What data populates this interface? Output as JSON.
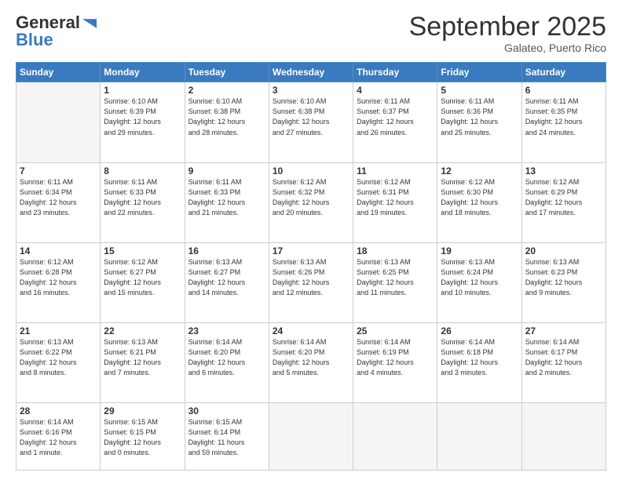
{
  "header": {
    "logo_general": "General",
    "logo_blue": "Blue",
    "month_title": "September 2025",
    "location": "Galateo, Puerto Rico"
  },
  "weekdays": [
    "Sunday",
    "Monday",
    "Tuesday",
    "Wednesday",
    "Thursday",
    "Friday",
    "Saturday"
  ],
  "weeks": [
    [
      {
        "day": "",
        "info": ""
      },
      {
        "day": "1",
        "info": "Sunrise: 6:10 AM\nSunset: 6:39 PM\nDaylight: 12 hours\nand 29 minutes."
      },
      {
        "day": "2",
        "info": "Sunrise: 6:10 AM\nSunset: 6:38 PM\nDaylight: 12 hours\nand 28 minutes."
      },
      {
        "day": "3",
        "info": "Sunrise: 6:10 AM\nSunset: 6:38 PM\nDaylight: 12 hours\nand 27 minutes."
      },
      {
        "day": "4",
        "info": "Sunrise: 6:11 AM\nSunset: 6:37 PM\nDaylight: 12 hours\nand 26 minutes."
      },
      {
        "day": "5",
        "info": "Sunrise: 6:11 AM\nSunset: 6:36 PM\nDaylight: 12 hours\nand 25 minutes."
      },
      {
        "day": "6",
        "info": "Sunrise: 6:11 AM\nSunset: 6:35 PM\nDaylight: 12 hours\nand 24 minutes."
      }
    ],
    [
      {
        "day": "7",
        "info": "Sunrise: 6:11 AM\nSunset: 6:34 PM\nDaylight: 12 hours\nand 23 minutes."
      },
      {
        "day": "8",
        "info": "Sunrise: 6:11 AM\nSunset: 6:33 PM\nDaylight: 12 hours\nand 22 minutes."
      },
      {
        "day": "9",
        "info": "Sunrise: 6:11 AM\nSunset: 6:33 PM\nDaylight: 12 hours\nand 21 minutes."
      },
      {
        "day": "10",
        "info": "Sunrise: 6:12 AM\nSunset: 6:32 PM\nDaylight: 12 hours\nand 20 minutes."
      },
      {
        "day": "11",
        "info": "Sunrise: 6:12 AM\nSunset: 6:31 PM\nDaylight: 12 hours\nand 19 minutes."
      },
      {
        "day": "12",
        "info": "Sunrise: 6:12 AM\nSunset: 6:30 PM\nDaylight: 12 hours\nand 18 minutes."
      },
      {
        "day": "13",
        "info": "Sunrise: 6:12 AM\nSunset: 6:29 PM\nDaylight: 12 hours\nand 17 minutes."
      }
    ],
    [
      {
        "day": "14",
        "info": "Sunrise: 6:12 AM\nSunset: 6:28 PM\nDaylight: 12 hours\nand 16 minutes."
      },
      {
        "day": "15",
        "info": "Sunrise: 6:12 AM\nSunset: 6:27 PM\nDaylight: 12 hours\nand 15 minutes."
      },
      {
        "day": "16",
        "info": "Sunrise: 6:13 AM\nSunset: 6:27 PM\nDaylight: 12 hours\nand 14 minutes."
      },
      {
        "day": "17",
        "info": "Sunrise: 6:13 AM\nSunset: 6:26 PM\nDaylight: 12 hours\nand 12 minutes."
      },
      {
        "day": "18",
        "info": "Sunrise: 6:13 AM\nSunset: 6:25 PM\nDaylight: 12 hours\nand 11 minutes."
      },
      {
        "day": "19",
        "info": "Sunrise: 6:13 AM\nSunset: 6:24 PM\nDaylight: 12 hours\nand 10 minutes."
      },
      {
        "day": "20",
        "info": "Sunrise: 6:13 AM\nSunset: 6:23 PM\nDaylight: 12 hours\nand 9 minutes."
      }
    ],
    [
      {
        "day": "21",
        "info": "Sunrise: 6:13 AM\nSunset: 6:22 PM\nDaylight: 12 hours\nand 8 minutes."
      },
      {
        "day": "22",
        "info": "Sunrise: 6:13 AM\nSunset: 6:21 PM\nDaylight: 12 hours\nand 7 minutes."
      },
      {
        "day": "23",
        "info": "Sunrise: 6:14 AM\nSunset: 6:20 PM\nDaylight: 12 hours\nand 6 minutes."
      },
      {
        "day": "24",
        "info": "Sunrise: 6:14 AM\nSunset: 6:20 PM\nDaylight: 12 hours\nand 5 minutes."
      },
      {
        "day": "25",
        "info": "Sunrise: 6:14 AM\nSunset: 6:19 PM\nDaylight: 12 hours\nand 4 minutes."
      },
      {
        "day": "26",
        "info": "Sunrise: 6:14 AM\nSunset: 6:18 PM\nDaylight: 12 hours\nand 3 minutes."
      },
      {
        "day": "27",
        "info": "Sunrise: 6:14 AM\nSunset: 6:17 PM\nDaylight: 12 hours\nand 2 minutes."
      }
    ],
    [
      {
        "day": "28",
        "info": "Sunrise: 6:14 AM\nSunset: 6:16 PM\nDaylight: 12 hours\nand 1 minute."
      },
      {
        "day": "29",
        "info": "Sunrise: 6:15 AM\nSunset: 6:15 PM\nDaylight: 12 hours\nand 0 minutes."
      },
      {
        "day": "30",
        "info": "Sunrise: 6:15 AM\nSunset: 6:14 PM\nDaylight: 11 hours\nand 59 minutes."
      },
      {
        "day": "",
        "info": ""
      },
      {
        "day": "",
        "info": ""
      },
      {
        "day": "",
        "info": ""
      },
      {
        "day": "",
        "info": ""
      }
    ]
  ]
}
